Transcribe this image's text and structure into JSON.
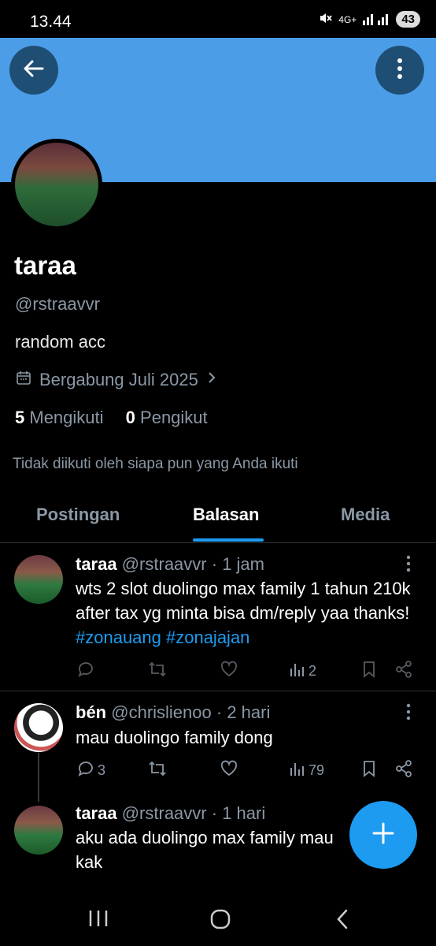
{
  "status": {
    "time": "13.44",
    "network": "4G+",
    "battery": "43"
  },
  "profile": {
    "name": "taraa",
    "handle": "@rstraavvr",
    "bio": "random acc",
    "joined": "Bergabung Juli 2025",
    "following_count": "5",
    "following_label": "Mengikuti",
    "followers_count": "0",
    "followers_label": "Pengikut",
    "not_followed_note": "Tidak diikuti oleh siapa pun yang Anda ikuti"
  },
  "tabs": [
    {
      "label": "Postingan",
      "active": false
    },
    {
      "label": "Balasan",
      "active": true
    },
    {
      "label": "Media",
      "active": false
    }
  ],
  "posts": [
    {
      "name": "taraa",
      "handle": "@rstraavvr",
      "time": "· 1 jam",
      "text": "wts 2 slot duolingo max family 1 tahun 210k after tax yg minta bisa dm/reply yaa thanks!",
      "hashtags": "#zonauang #zonajajan",
      "replies": "",
      "views": "2"
    },
    {
      "name": "bén",
      "handle": "@chrislienoo",
      "time": "· 2 hari",
      "text": "mau duolingo family dong",
      "replies": "3",
      "views": "79"
    },
    {
      "name": "taraa",
      "handle": "@rstraavvr",
      "time": "· 1 hari",
      "text": "aku ada duolingo max family mau kak"
    }
  ],
  "colors": {
    "banner": "#4b9de8",
    "accent": "#1d9bf0"
  }
}
